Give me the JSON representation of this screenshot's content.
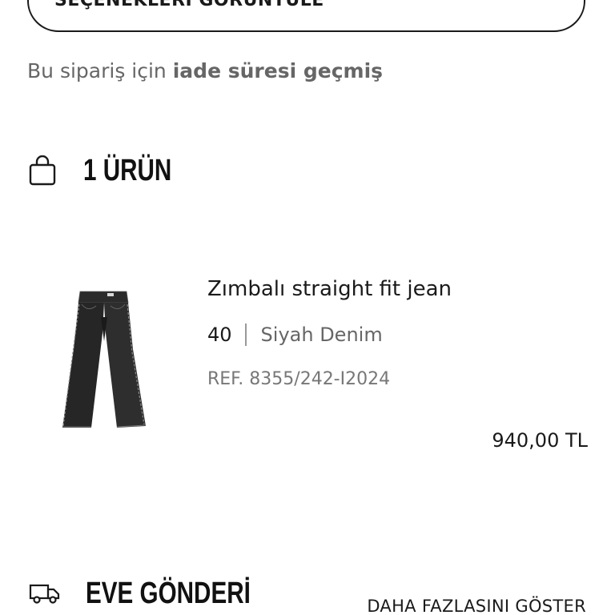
{
  "options_button": {
    "label": "SEÇENEKLERİ GÖRÜNTÜLE",
    "icon": "chevron-icon"
  },
  "return_note": {
    "prefix": "Bu sipariş için ",
    "emphasis": "iade süresi geçmiş"
  },
  "items_section": {
    "icon": "shopping-bag-icon",
    "title": "1 ÜRÜN"
  },
  "product": {
    "image": "black-straight-jeans-image",
    "name": "Zımbalı straight fit jean",
    "size": "40",
    "color": "Siyah Denim",
    "ref": "REF. 8355/242-I2024",
    "price": "940,00 TL"
  },
  "delivery_section": {
    "icon": "delivery-truck-icon",
    "title": "EVE GÖNDERİ",
    "show_more": "DAHA FAZLASINI GÖSTER"
  }
}
